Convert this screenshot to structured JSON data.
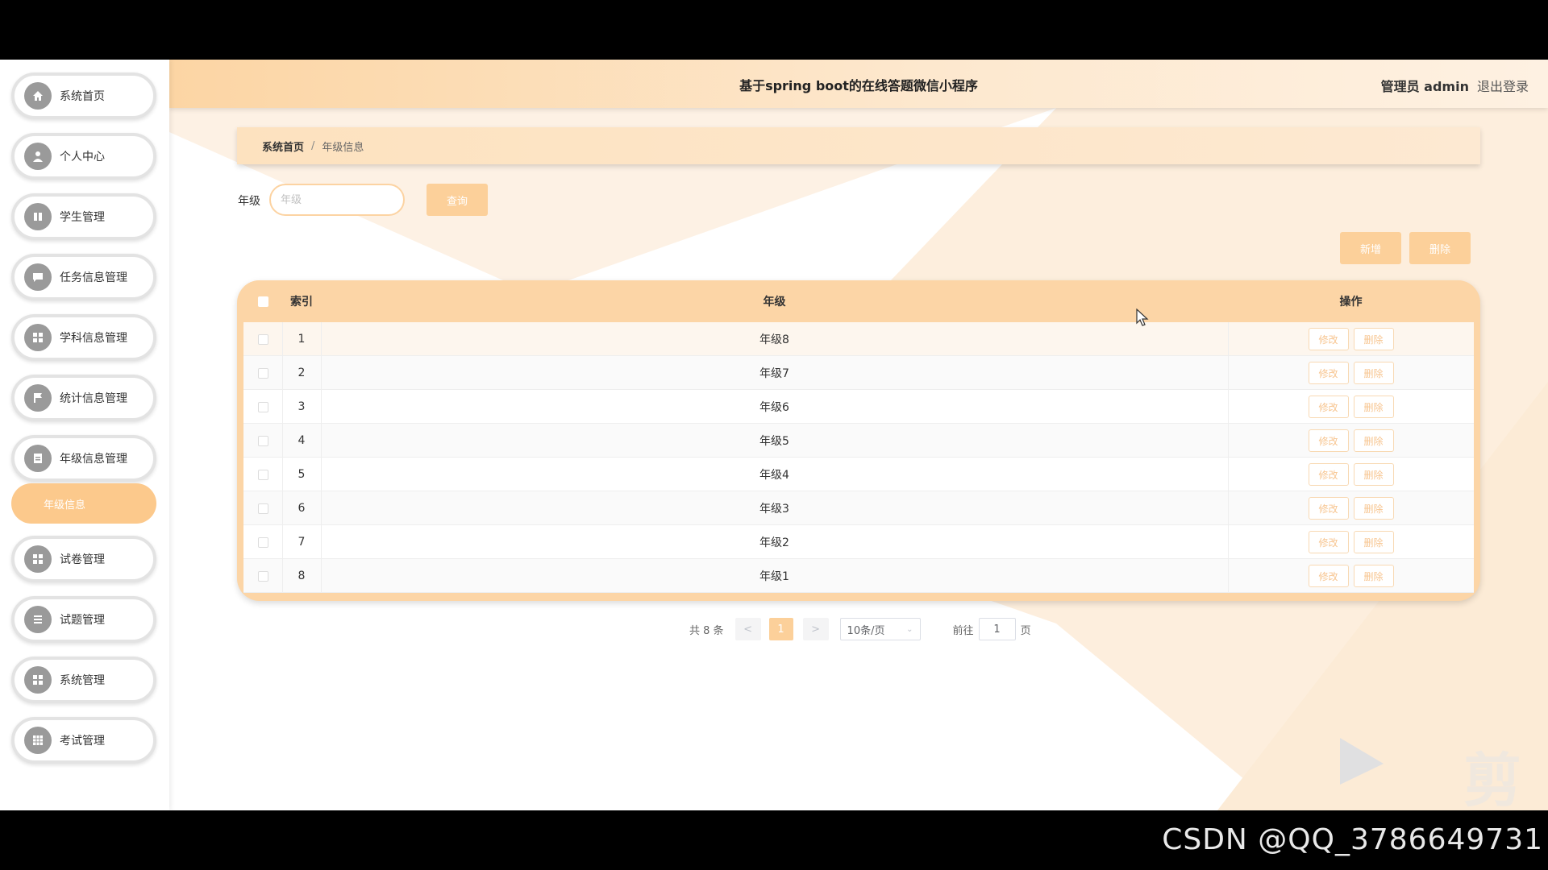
{
  "app": {
    "title": "基于spring boot的在线答题微信小程序",
    "user": "管理员 admin",
    "logout": "退出登录"
  },
  "sidebar": {
    "items": [
      {
        "label": "系统首页",
        "icon": "home-icon"
      },
      {
        "label": "个人中心",
        "icon": "user-icon"
      },
      {
        "label": "学生管理",
        "icon": "book-icon"
      },
      {
        "label": "任务信息管理",
        "icon": "chat-icon"
      },
      {
        "label": "学科信息管理",
        "icon": "grid-icon"
      },
      {
        "label": "统计信息管理",
        "icon": "flag-icon"
      },
      {
        "label": "年级信息管理",
        "icon": "document-icon"
      },
      {
        "label": "试卷管理",
        "icon": "grid-icon"
      },
      {
        "label": "试题管理",
        "icon": "list-icon"
      },
      {
        "label": "系统管理",
        "icon": "grid-icon"
      },
      {
        "label": "考试管理",
        "icon": "table-icon"
      }
    ],
    "sub_item": "年级信息"
  },
  "breadcrumb": {
    "home": "系统首页",
    "separator": "/",
    "current": "年级信息"
  },
  "search": {
    "label": "年级",
    "placeholder": "年级",
    "query_button": "查询"
  },
  "toolbar": {
    "add": "新增",
    "delete": "删除"
  },
  "table": {
    "columns": [
      "索引",
      "年级",
      "操作"
    ],
    "rows": [
      {
        "index": "1",
        "grade": "年级8"
      },
      {
        "index": "2",
        "grade": "年级7"
      },
      {
        "index": "3",
        "grade": "年级6"
      },
      {
        "index": "4",
        "grade": "年级5"
      },
      {
        "index": "5",
        "grade": "年级4"
      },
      {
        "index": "6",
        "grade": "年级3"
      },
      {
        "index": "7",
        "grade": "年级2"
      },
      {
        "index": "8",
        "grade": "年级1"
      }
    ],
    "edit_label": "修改",
    "delete_label": "删除"
  },
  "pagination": {
    "total": "共 8 条",
    "prev": "<",
    "current_page": "1",
    "next": ">",
    "page_size": "10条/页",
    "goto_label": "前往",
    "goto_value": "1",
    "page_suffix": "页"
  },
  "watermark": {
    "editor": "剪辑",
    "csdn": "CSDN @QQ_3786649731"
  },
  "colors": {
    "accent": "#fcd09a",
    "header_start": "#fcd5a4",
    "table_header": "#fcd5a6",
    "icon_gray": "#9a9a9a"
  }
}
